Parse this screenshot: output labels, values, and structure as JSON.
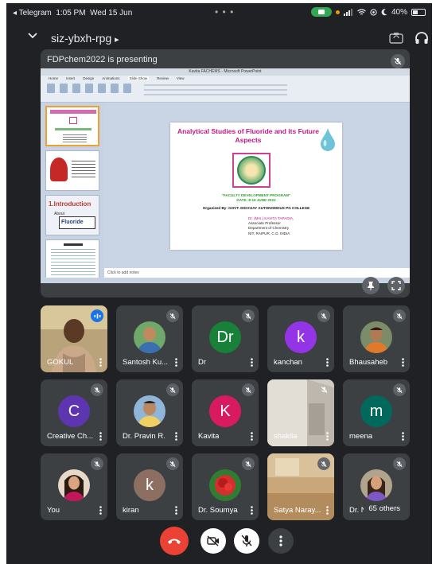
{
  "status_bar": {
    "back_app": "◂ Telegram",
    "time": "1:05 PM",
    "date": "Wed 15 Jun",
    "dots": "• • •",
    "battery": "40%"
  },
  "header": {
    "meeting_code": "siz-ybxh-rpg",
    "code_suffix": "▸"
  },
  "presentation": {
    "presenter_label": "FDPchem2022 is presenting",
    "window_title": "Kavita FACHEMS - Microsoft PowerPoint",
    "ribbon_tabs": [
      "Home",
      "Insert",
      "Design",
      "Animations",
      "Slide Show",
      "Review",
      "View"
    ],
    "notes_placeholder": "Click to add notes",
    "slide": {
      "title": "Analytical Studies of Fluoride and its Future Aspects",
      "program": "\"FACULTY DEVELOPMENT PROGRAM\"",
      "dates": "DATE: 8-15 JUNE 2022",
      "organizer": "Organized By: GOVT. DIGVIJAY AUTONOMOUS PG COLLEGE",
      "author_name": "Dr. (Mrs.) KAVITA TAPADIA,",
      "author_role": "Associate Professor",
      "author_dept": "Department of Chemistry",
      "author_inst": "NIT, RAIPUR, C.G. INDIA"
    },
    "thumb_intro": "1.Introduction",
    "thumb_about": "About",
    "thumb_fluoride": "Fluoride"
  },
  "participants": [
    {
      "name": "GOKUL",
      "initial": "",
      "color": "",
      "mic": "speaking"
    },
    {
      "name": "Santosh Ku...",
      "initial": "",
      "color": "",
      "mic": "muted"
    },
    {
      "name": "Dr",
      "initial": "Dr",
      "color": "#188038",
      "mic": "muted"
    },
    {
      "name": "kanchan",
      "initial": "k",
      "color": "#9334e6",
      "mic": "muted"
    },
    {
      "name": "Bhausaheb",
      "initial": "",
      "color": "",
      "mic": "muted"
    },
    {
      "name": "Creative Ch...",
      "initial": "C",
      "color": "#5e35b1",
      "mic": "muted"
    },
    {
      "name": "Dr. Pravin R.",
      "initial": "",
      "color": "",
      "mic": "muted"
    },
    {
      "name": "Kavita",
      "initial": "K",
      "color": "#d81b60",
      "mic": "muted"
    },
    {
      "name": "shakila",
      "initial": "",
      "color": "",
      "mic": "muted"
    },
    {
      "name": "meena",
      "initial": "m",
      "color": "#00695c",
      "mic": "muted"
    },
    {
      "name": "You",
      "initial": "",
      "color": "",
      "mic": "muted"
    },
    {
      "name": "kiran",
      "initial": "k",
      "color": "#8d6e63",
      "mic": "muted"
    },
    {
      "name": "Dr. Soumya",
      "initial": "",
      "color": "",
      "mic": "muted"
    },
    {
      "name": "Satya Naray...",
      "initial": "",
      "color": "",
      "mic": "muted"
    },
    {
      "name": "Dr. N",
      "initial": "",
      "color": "",
      "mic": "muted"
    }
  ],
  "others_count": "65 others",
  "controls": {
    "end_call_color": "#ea4335",
    "camera": "camera-off",
    "mic": "mic-off",
    "more": "more-options"
  }
}
